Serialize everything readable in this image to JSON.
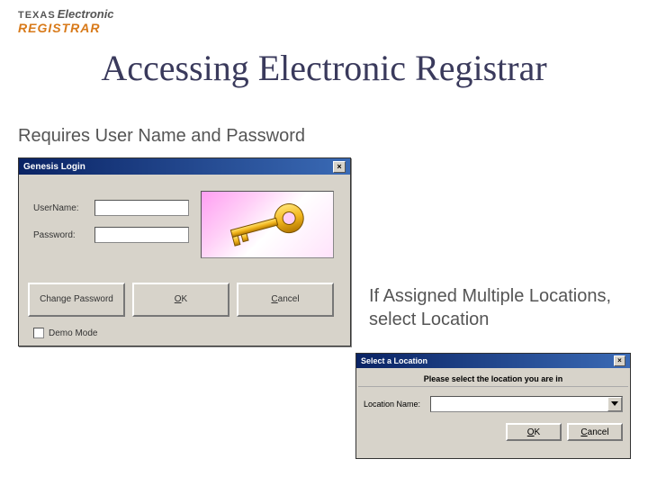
{
  "logo": {
    "line1": "TEXAS",
    "line2": "Electronic",
    "line3": "REGISTRAR"
  },
  "title": "Accessing Electronic Registrar",
  "subtitle": "Requires User Name and Password",
  "login": {
    "window_title": "Genesis Login",
    "username_label": "UserName:",
    "password_label": "Password:",
    "change_pw_label": "Change Password",
    "ok_label": "OK",
    "cancel_label": "Cancel",
    "demo_label": "Demo Mode"
  },
  "caption2": "If Assigned Multiple Locations, select Location",
  "locdlg": {
    "window_title": "Select a Location",
    "prompt": "Please select the location you are in",
    "name_label": "Location Name:",
    "ok_label": "OK",
    "cancel_label": "Cancel"
  }
}
